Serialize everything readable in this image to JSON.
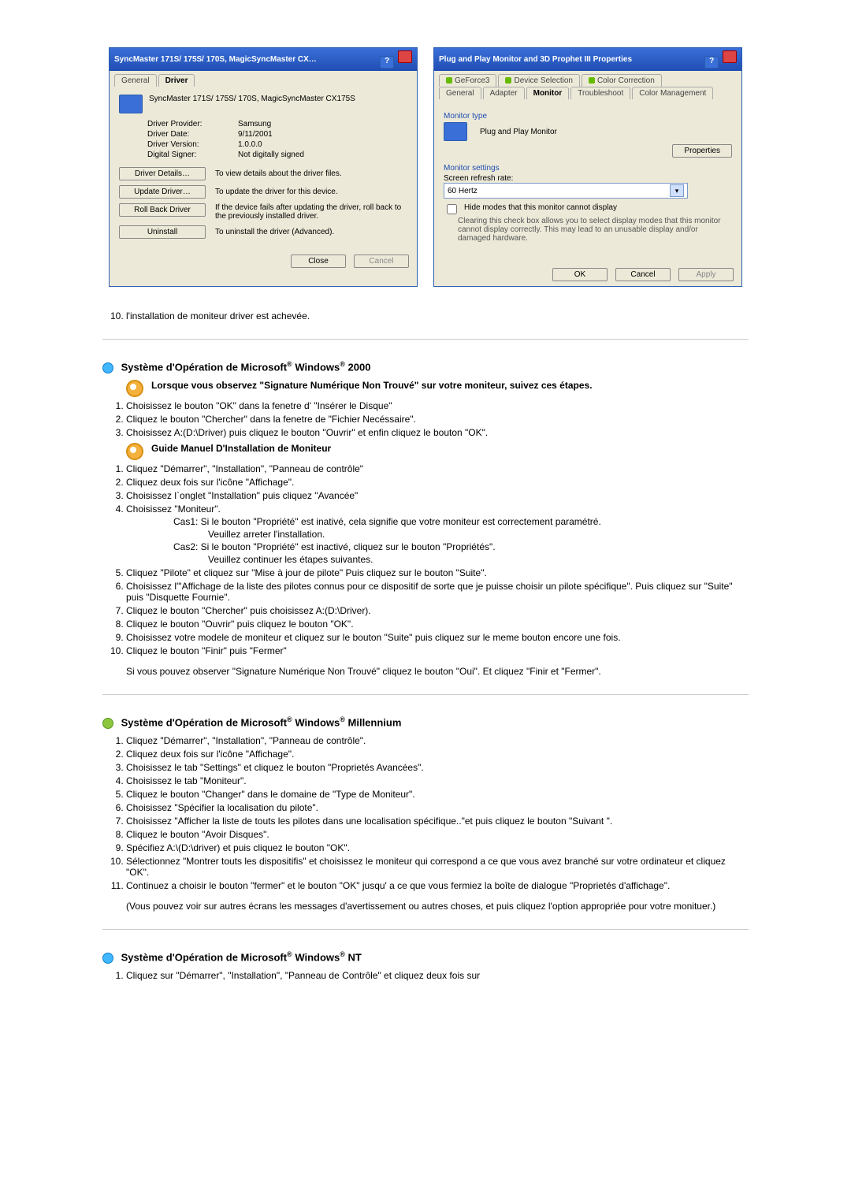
{
  "dlg1": {
    "title": "SyncMaster 171S/ 175S/ 170S, MagicSyncMaster CX…",
    "tabs": {
      "general": "General",
      "driver": "Driver"
    },
    "model": "SyncMaster 171S/ 175S/ 170S, MagicSyncMaster CX175S",
    "rows": {
      "provider_k": "Driver Provider:",
      "provider_v": "Samsung",
      "date_k": "Driver Date:",
      "date_v": "9/11/2001",
      "version_k": "Driver Version:",
      "version_v": "1.0.0.0",
      "signer_k": "Digital Signer:",
      "signer_v": "Not digitally signed"
    },
    "btns": {
      "details": "Driver Details…",
      "details_d": "To view details about the driver files.",
      "update": "Update Driver…",
      "update_d": "To update the driver for this device.",
      "roll": "Roll Back Driver",
      "roll_d": "If the device fails after updating the driver, roll back to the previously installed driver.",
      "uninst": "Uninstall",
      "uninst_d": "To uninstall the driver (Advanced).",
      "close": "Close",
      "cancel": "Cancel"
    }
  },
  "dlg2": {
    "title": "Plug and Play Monitor and 3D Prophet III Properties",
    "tabsTop": {
      "gf": "GeForce3",
      "devsel": "Device Selection",
      "colcorr": "Color Correction"
    },
    "tabsBot": {
      "gen": "General",
      "adapter": "Adapter",
      "monitor": "Monitor",
      "trouble": "Troubleshoot",
      "colmgmt": "Color Management"
    },
    "montype_label": "Monitor type",
    "montype_value": "Plug and Play Monitor",
    "props_btn": "Properties",
    "monset_label": "Monitor settings",
    "refresh_label": "Screen refresh rate:",
    "refresh_val": "60 Hertz",
    "hide": "Hide modes that this monitor cannot display",
    "hide_note": "Clearing this check box allows you to select display modes that this monitor cannot display correctly. This may lead to an unusable display and/or damaged hardware.",
    "ok": "OK",
    "cancel": "Cancel",
    "apply": "Apply"
  },
  "preamble_item": "l'installation de moniteur driver est achevée.",
  "sec2000": {
    "title_a": "Système d'Opération de Microsoft",
    "title_b": " Windows",
    "title_c": " 2000",
    "sub1": "Lorsque vous observez \"Signature Numérique Non Trouvé\" sur votre moniteur, suivez ces étapes.",
    "s1": [
      "Choisissez le bouton \"OK\" dans la fenetre d' \"Insérer le Disque\"",
      "Cliquez le bouton \"Chercher\" dans la fenetre de \"Fichier Necéssaire\".",
      "Choisissez A:(D:\\Driver) puis cliquez le bouton \"Ouvrir\" et enfin cliquez le bouton \"OK\"."
    ],
    "sub2": "Guide Manuel D'Installation de Moniteur",
    "s2_1": "Cliquez \"Démarrer\", \"Installation\", \"Panneau de contrôle\"",
    "s2_2": "Cliquez deux fois sur l'icône \"Affichage\".",
    "s2_3": "Choisissez l`onglet \"Installation\" puis cliquez \"Avancée\"",
    "s2_4": "Choisissez \"Moniteur\".",
    "cas1a": "Cas1:  Si le bouton \"Propriété\" est inativé, cela signifie que votre moniteur est correctement paramétré.",
    "cas1b": "Veuillez arreter l'installation.",
    "cas2a": "Cas2:  Si le bouton \"Propriété\" est inactivé, cliquez sur le bouton \"Propriétés\".",
    "cas2b": "Veuillez continuer les étapes suivantes.",
    "s2_5": "Cliquez \"Pilote\" et cliquez sur \"Mise à jour de pilote\" Puis cliquez sur le bouton \"Suite\".",
    "s2_6": "Choisissez l'\"Affichage de la liste des pilotes connus pour ce dispositif de sorte que je puisse choisir un pilote spécifique\". Puis cliquez sur \"Suite\" puis \"Disquette Fournie\".",
    "s2_7": "Cliquez le bouton \"Chercher\" puis choisissez A:(D:\\Driver).",
    "s2_8": "Cliquez le bouton \"Ouvrir\" puis cliquez le bouton \"OK\".",
    "s2_9": "Choisissez votre modele de moniteur et cliquez sur le bouton \"Suite\" puis cliquez sur le meme bouton encore une fois.",
    "s2_10": "Cliquez le bouton \"Finir\" puis \"Fermer\"",
    "tail": "Si vous pouvez observer \"Signature Numérique Non Trouvé\" cliquez le bouton \"Oui\". Et cliquez \"Finir et \"Fermer\"."
  },
  "secME": {
    "title_a": "Système d'Opération de Microsoft",
    "title_b": " Windows",
    "title_c": " Millennium",
    "items": [
      "Cliquez \"Démarrer\", \"Installation\", \"Panneau de contrôle\".",
      "Cliquez deux fois sur l'icône \"Affichage\".",
      "Choisissez le tab \"Settings\" et cliquez le bouton \"Proprietés Avancées\".",
      "Choisissez le tab \"Moniteur\".",
      "Cliquez le bouton \"Changer\" dans le domaine de \"Type de Moniteur\".",
      "Choisissez \"Spécifier la localisation du pilote\".",
      "Choisissez \"Afficher la liste de touts les pilotes dans une localisation spécifique..\"et puis cliquez le bouton \"Suivant \".",
      "Cliquez le bouton \"Avoir Disques\".",
      "Spécifiez A:\\(D:\\driver) et puis cliquez le bouton \"OK\".",
      "Sélectionnez \"Montrer touts les dispositifis\" et choisissez le moniteur qui correspond a ce que vous avez branché sur votre ordinateur et cliquez \"OK\".",
      "Continuez a choisir le bouton \"fermer\" et le bouton \"OK\" jusqu' a ce que vous fermiez la boîte de dialogue \"Proprietés d'affichage\"."
    ],
    "tail": "(Vous pouvez voir sur autres écrans les messages d'avertissement ou autres choses, et puis cliquez l'option appropriée pour votre monituer.)"
  },
  "secNT": {
    "title_a": "Système d'Opération de Microsoft",
    "title_b": " Windows",
    "title_c": " NT",
    "item1": "Cliquez sur \"Démarrer\", \"Installation\", \"Panneau de Contrôle\" et cliquez deux fois sur"
  }
}
